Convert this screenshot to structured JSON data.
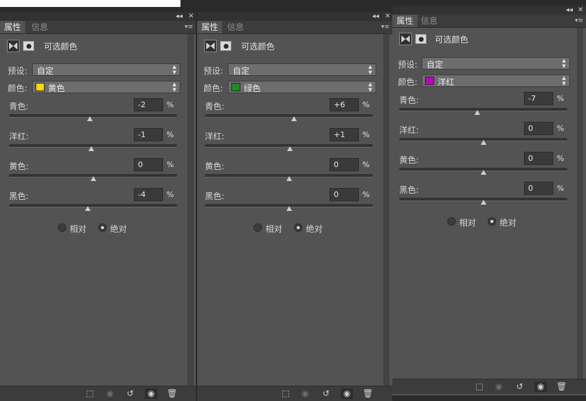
{
  "panels": [
    {
      "tabs": [
        "属性",
        "信息"
      ],
      "window_controls": {
        "collapse": "◂◂",
        "close": "✕"
      },
      "menu": "▾≡",
      "header_title": "可选颜色",
      "preset_label": "预设:",
      "preset_value": "自定",
      "colors_label": "颜色:",
      "colors_value": "黄色",
      "swatch_color": "#ffd800",
      "sliders": [
        {
          "label": "青色:",
          "value": "-2",
          "unit": "%",
          "position": 0.48
        },
        {
          "label": "洋红:",
          "value": "-1",
          "unit": "%",
          "position": 0.49
        },
        {
          "label": "黄色:",
          "value": "0",
          "unit": "%",
          "position": 0.5
        },
        {
          "label": "黑色:",
          "value": "-4",
          "unit": "%",
          "position": 0.47
        }
      ],
      "method_relative": "相对",
      "method_absolute": "绝对",
      "selected_method": "absolute",
      "bottom_icons": [
        "clip-to-layer-icon",
        "view-previous-state-icon",
        "reset-icon",
        "visibility-eye-icon",
        "trash-icon"
      ]
    },
    {
      "tabs": [
        "属性",
        "信息"
      ],
      "window_controls": {
        "collapse": "◂◂",
        "close": "✕"
      },
      "menu": "▾≡",
      "header_title": "可选颜色",
      "preset_label": "预设:",
      "preset_value": "自定",
      "colors_label": "颜色:",
      "colors_value": "绿色",
      "swatch_color": "#1f8a1f",
      "sliders": [
        {
          "label": "青色:",
          "value": "+6",
          "unit": "%",
          "position": 0.53
        },
        {
          "label": "洋红:",
          "value": "+1",
          "unit": "%",
          "position": 0.505
        },
        {
          "label": "黄色:",
          "value": "0",
          "unit": "%",
          "position": 0.5
        },
        {
          "label": "黑色:",
          "value": "0",
          "unit": "%",
          "position": 0.5
        }
      ],
      "method_relative": "相对",
      "method_absolute": "绝对",
      "selected_method": "absolute",
      "bottom_icons": [
        "clip-to-layer-icon",
        "view-previous-state-icon",
        "reset-icon",
        "visibility-eye-icon",
        "trash-icon"
      ]
    },
    {
      "tabs": [
        "属性",
        "信息"
      ],
      "window_controls": {
        "collapse": "◂◂",
        "close": "✕"
      },
      "menu": "▾≡",
      "header_title": "可选颜色",
      "preset_label": "预设:",
      "preset_value": "自定",
      "colors_label": "颜色:",
      "colors_value": "洋红",
      "swatch_color": "#c000c0",
      "sliders": [
        {
          "label": "青色:",
          "value": "-7",
          "unit": "%",
          "position": 0.465
        },
        {
          "label": "洋红:",
          "value": "0",
          "unit": "%",
          "position": 0.5
        },
        {
          "label": "黄色:",
          "value": "0",
          "unit": "%",
          "position": 0.5
        },
        {
          "label": "黑色:",
          "value": "0",
          "unit": "%",
          "position": 0.5
        }
      ],
      "method_relative": "相对",
      "method_absolute": "绝对",
      "selected_method": "absolute",
      "bottom_icons": [
        "clip-to-layer-icon",
        "view-previous-state-icon",
        "reset-icon",
        "visibility-eye-icon",
        "trash-icon"
      ]
    }
  ]
}
